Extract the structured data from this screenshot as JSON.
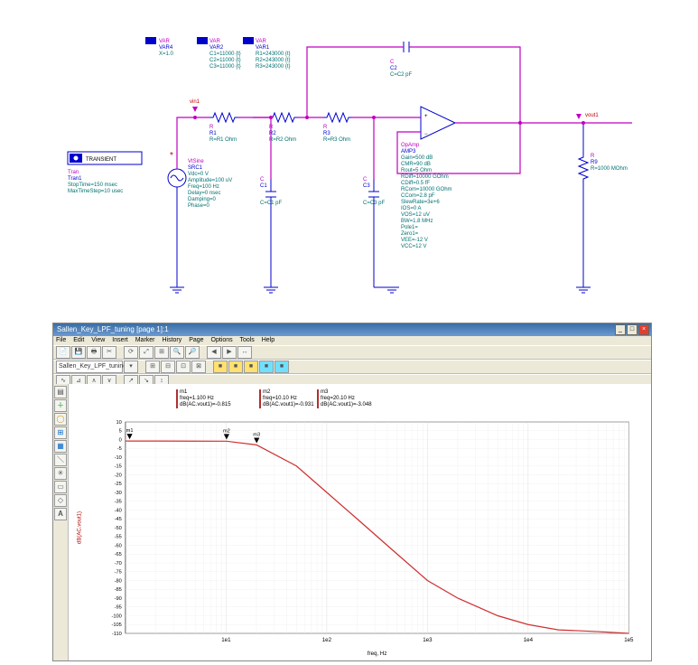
{
  "schematic": {
    "var4": {
      "h": "VAR",
      "l1": "VAR4",
      "l2": "X=1.0"
    },
    "var2": {
      "h": "VAR",
      "l1": "VAR2",
      "l2": "C1=11000 {t}",
      "l3": "C2=11000 {t}",
      "l4": "C3=11000 {t}"
    },
    "var1": {
      "h": "VAR",
      "l1": "VAR1",
      "l2": "R1=243000 {t}",
      "l3": "R2=243000 {t}",
      "l4": "R3=243000 {t}"
    },
    "tran": {
      "box": "TRANSIENT",
      "h": "Tran",
      "l1": "Tran1",
      "l2": "StopTime=150 msec",
      "l3": "MaxTimeStep=10 usec"
    },
    "src": {
      "h": "VtSine",
      "l1": "SRC1",
      "l2": "Vdc=0 V",
      "l3": "Amplitude=100 uV",
      "l4": "Freq=100 Hz",
      "l5": "Delay=0 nsec",
      "l6": "Damping=0",
      "l7": "Phase=0"
    },
    "r1": {
      "h": "R",
      "l1": "R1",
      "l2": "R=R1 Ohm"
    },
    "r2": {
      "h": "R",
      "l1": "R2",
      "l2": "R=R2 Ohm"
    },
    "r3": {
      "h": "R",
      "l1": "R3",
      "l2": "R=R3 Ohm"
    },
    "r9": {
      "h": "R",
      "l1": "R9",
      "l2": "R=1000 MOhm"
    },
    "c1": {
      "h": "C",
      "l1": "C1",
      "l2": "C=C1 pF"
    },
    "c2": {
      "h": "C",
      "l1": "C2",
      "l2": "C=C2 pF"
    },
    "c3": {
      "h": "C",
      "l1": "C3",
      "l2": "C=C3 pF"
    },
    "net_in": "vin1",
    "net_out": "vout1",
    "opamp": {
      "h": "OpAmp",
      "n": "AMP3",
      "p": [
        "Gain=500 dB",
        "CMR=90 dB",
        "Rout=5 Ohm",
        "RDiff=10000 GOhm",
        "CDiff=0.5 fF",
        "RCom=10000 GOhm",
        "CCom=2.8 pF",
        "SlewRate=3e+6",
        "IOS=0 A",
        "VOS=12 uV",
        "BW=1.8 MHz",
        "Pole1=",
        "Zero1=",
        "VEE=-12 V",
        "VCC=12 V"
      ]
    }
  },
  "plot": {
    "title": "Sallen_Key_LPF_tuning  [page 1]:1",
    "menu": [
      "File",
      "Edit",
      "View",
      "Insert",
      "Marker",
      "History",
      "Page",
      "Options",
      "Tools",
      "Help"
    ],
    "combo": "Sallen_Key_LPF_tuning",
    "ylabel": "dB(AC.vout1)",
    "xlabel": "freq, Hz",
    "xticks": [
      "1e1",
      "1e2",
      "1e3",
      "1e4",
      "1e5"
    ],
    "yticks": [
      "10",
      "5",
      "0",
      "-5",
      "-10",
      "-15",
      "-20",
      "-25",
      "-30",
      "-35",
      "-40",
      "-45",
      "-50",
      "-55",
      "-60",
      "-65",
      "-70",
      "-75",
      "-80",
      "-85",
      "-90",
      "-95",
      "-100",
      "-105",
      "-110"
    ],
    "markers": [
      {
        "n": "m1",
        "l1": "freq=1.100 Hz",
        "l2": "dB(AC.vout1)=-0.815"
      },
      {
        "n": "m2",
        "l1": "freq=10.10 Hz",
        "l2": "dB(AC.vout1)=-0.931"
      },
      {
        "n": "m3",
        "l1": "freq=20.10 Hz",
        "l2": "dB(AC.vout1)=-3.048"
      }
    ],
    "chart_data": {
      "type": "line",
      "xlabel": "freq, Hz",
      "ylabel": "dB(AC.vout1)",
      "x_scale": "log",
      "xlim": [
        1,
        100000
      ],
      "ylim": [
        -110,
        10
      ],
      "series": [
        {
          "name": "dB(AC.vout1)",
          "x": [
            1,
            1.1,
            2,
            5,
            10,
            10.1,
            20,
            20.1,
            50,
            100,
            200,
            500,
            1000,
            2000,
            5000,
            10000,
            20000,
            50000,
            100000
          ],
          "y": [
            -0.8,
            -0.815,
            -0.85,
            -0.9,
            -0.93,
            -0.931,
            -3.0,
            -3.048,
            -15,
            -30,
            -45,
            -65,
            -80,
            -90,
            -100,
            -105,
            -108,
            -109,
            -110
          ]
        }
      ]
    }
  }
}
